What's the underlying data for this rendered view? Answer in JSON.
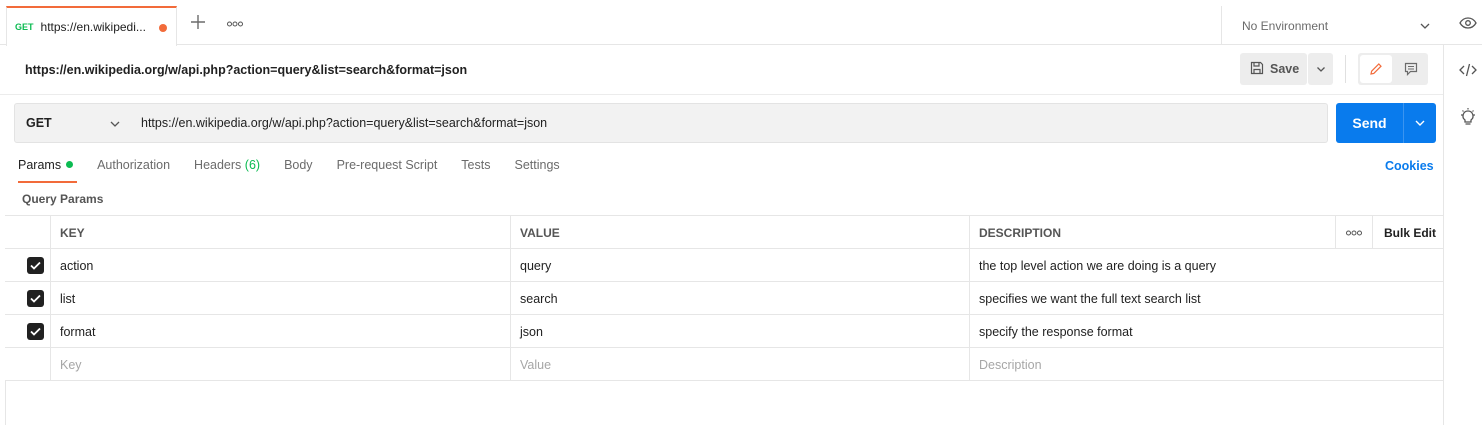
{
  "tabbar": {
    "request_tab": {
      "method": "GET",
      "title": "https://en.wikipedi..."
    },
    "environment": "No Environment"
  },
  "request": {
    "name": "https://en.wikipedia.org/w/api.php?action=query&list=search&format=json",
    "save_label": "Save",
    "method": "GET",
    "url": "https://en.wikipedia.org/w/api.php?action=query&list=search&format=json",
    "send_label": "Send"
  },
  "subtabs": {
    "params": "Params",
    "authorization": "Authorization",
    "headers": "Headers",
    "headers_count": "(6)",
    "body": "Body",
    "prerequest": "Pre-request Script",
    "tests": "Tests",
    "settings": "Settings",
    "cookies": "Cookies"
  },
  "query_params": {
    "title": "Query Params",
    "columns": {
      "key": "KEY",
      "value": "VALUE",
      "description": "DESCRIPTION",
      "bulk_edit": "Bulk Edit"
    },
    "rows": [
      {
        "key": "action",
        "value": "query",
        "description": "the top level action we are doing is a query",
        "checked": true
      },
      {
        "key": "list",
        "value": "search",
        "description": "specifies we want the full text search list",
        "checked": true
      },
      {
        "key": "format",
        "value": "json",
        "description": "specify the response format",
        "checked": true
      }
    ],
    "placeholders": {
      "key": "Key",
      "value": "Value",
      "description": "Description"
    }
  },
  "colors": {
    "accent": "#f26b3a",
    "primary": "#097bed",
    "success": "#0cbb52"
  }
}
